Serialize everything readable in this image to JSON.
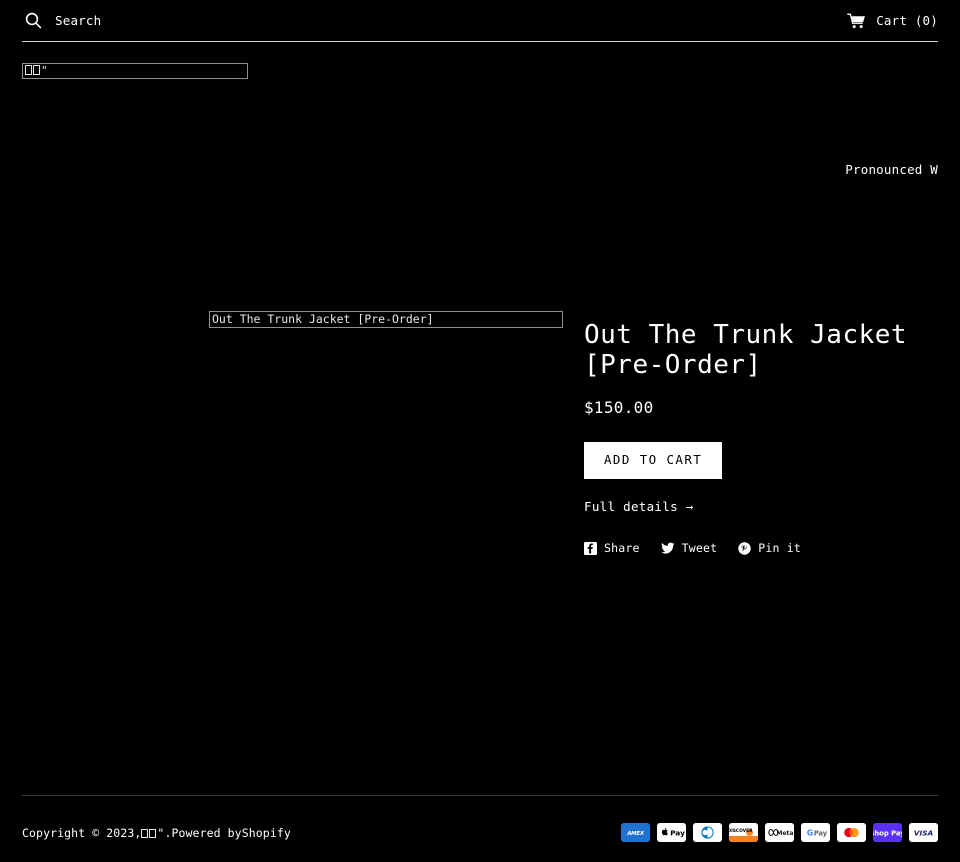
{
  "theme": {
    "background": "#000000",
    "text": "#ffffff",
    "rule": "#d8d8d8",
    "footer_rule": "#3a3a3a",
    "button_bg": "#ffffff",
    "button_text": "#000000"
  },
  "header": {
    "search_icon": "search-icon",
    "search_placeholder": "Search",
    "search_value": "",
    "cart_icon": "shopping-cart-icon",
    "cart_label": "Cart (0)"
  },
  "logo": {
    "alt_text": "□□\"",
    "is_broken_image": true
  },
  "announcement": {
    "text": "Pronounced W"
  },
  "product": {
    "media_alt": "Out The Trunk Jacket [Pre-Order]",
    "title": "Out The Trunk Jacket [Pre-Order]",
    "price": "$150.00",
    "add_to_cart_label": "ADD TO CART",
    "full_details_label": "Full details →",
    "share": [
      {
        "icon": "facebook-icon",
        "label": "Share"
      },
      {
        "icon": "twitter-icon",
        "label": "Tweet"
      },
      {
        "icon": "pinterest-icon",
        "label": "Pin it"
      }
    ]
  },
  "footer": {
    "copyright_prefix": "Copyright © 2023, ",
    "shop_name": "□□\"",
    "copyright_middle": ". ",
    "powered_by": "Powered by ",
    "powered_by_link": "Shopify",
    "payments": [
      {
        "name": "american-express",
        "label": "AMEX"
      },
      {
        "name": "apple-pay",
        "label": "Pay"
      },
      {
        "name": "diners-club",
        "label": ""
      },
      {
        "name": "discover",
        "label": "DISCOVER"
      },
      {
        "name": "meta-pay",
        "label": "Meta"
      },
      {
        "name": "google-pay",
        "label": "Pay"
      },
      {
        "name": "mastercard",
        "label": ""
      },
      {
        "name": "shop-pay",
        "label": "Pay"
      },
      {
        "name": "visa",
        "label": "VISA"
      }
    ]
  }
}
